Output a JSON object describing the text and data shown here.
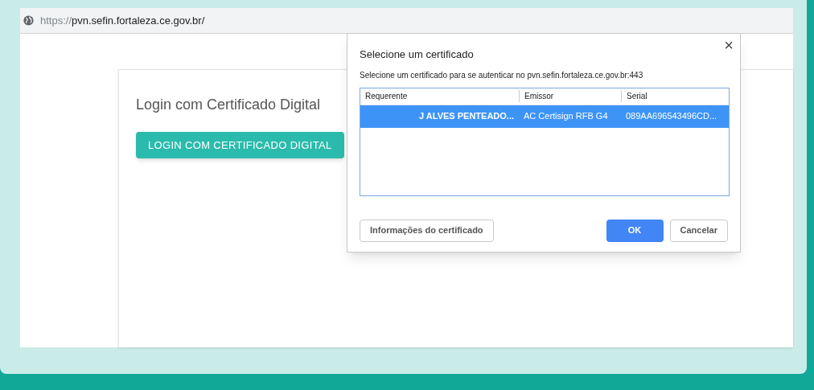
{
  "address_bar": {
    "scheme": "https://",
    "rest": "pvn.sefin.fortaleza.ce.gov.br/"
  },
  "page": {
    "heading": "Login com Certificado Digital",
    "button": "LOGIN COM CERTIFICADO DIGITAL"
  },
  "dialog": {
    "title": "Selecione um certificado",
    "close": "×",
    "message": "Selecione um certificado para se autenticar no pvn.sefin.fortaleza.ce.gov.br:443",
    "table": {
      "columns": [
        "Requerente",
        "Emissor",
        "Serial"
      ],
      "rows": [
        {
          "cells": [
            "J ALVES PENTEADO...",
            "AC Certisign RFB G4",
            "089AA696543496CD..."
          ],
          "selected": true
        }
      ]
    },
    "buttons": [
      {
        "label": "Informações do certificado",
        "kind": "secondary"
      },
      {
        "label": "OK",
        "kind": "primary"
      },
      {
        "label": "Cancelar",
        "kind": "secondary"
      }
    ]
  }
}
